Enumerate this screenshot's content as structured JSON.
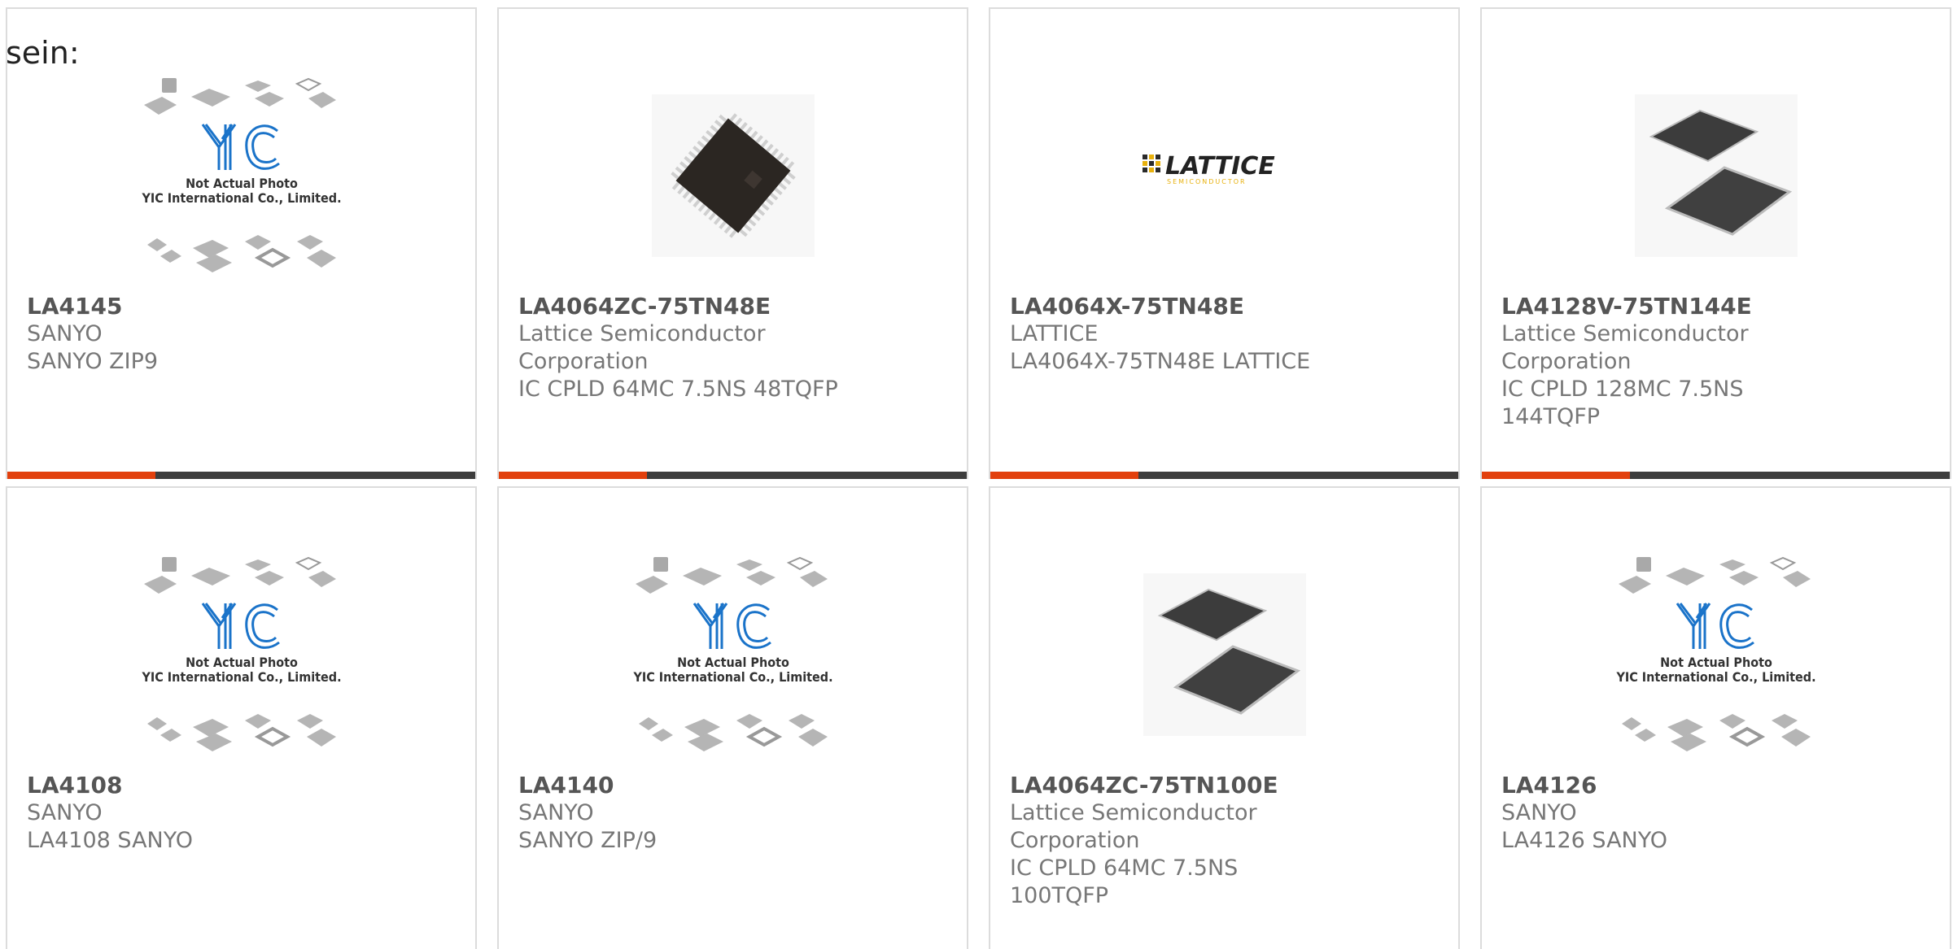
{
  "stray_text": "sein:",
  "placeholder": {
    "line1": "Not Actual Photo",
    "line2": "YIC International Co., Limited."
  },
  "logo_text": {
    "main": "LATTICE",
    "sub": "SEMICONDUCTOR"
  },
  "colors": {
    "accent": "#e2400d",
    "bar": "#3d3d3d",
    "border": "#dcdcdc",
    "yic_blue": "#1a73c9",
    "lattice_gold": "#e8b10d"
  },
  "cards": [
    {
      "part": "LA4145",
      "maker": "SANYO",
      "desc": "SANYO ZIP9",
      "image": "placeholder"
    },
    {
      "part": "LA4064ZC-75TN48E",
      "maker": "Lattice Semiconductor Corporation",
      "desc": "IC CPLD 64MC 7.5NS 48TQFP",
      "image": "chip-tqfp48"
    },
    {
      "part": "LA4064X-75TN48E",
      "maker": "LATTICE",
      "desc": "LA4064X-75TN48E LATTICE",
      "image": "lattice-logo"
    },
    {
      "part": "LA4128V-75TN144E",
      "maker": "Lattice Semiconductor Corporation",
      "desc": "IC CPLD 128MC 7.5NS 144TQFP",
      "image": "chip-pair"
    },
    {
      "part": "LA4108",
      "maker": "SANYO",
      "desc": "LA4108 SANYO",
      "image": "placeholder"
    },
    {
      "part": "LA4140",
      "maker": "SANYO",
      "desc": "SANYO ZIP/9",
      "image": "placeholder"
    },
    {
      "part": "LA4064ZC-75TN100E",
      "maker": "Lattice Semiconductor Corporation",
      "desc": "IC CPLD 64MC 7.5NS 100TQFP",
      "image": "chip-pair"
    },
    {
      "part": "LA4126",
      "maker": "SANYO",
      "desc": "LA4126 SANYO",
      "image": "placeholder"
    }
  ]
}
